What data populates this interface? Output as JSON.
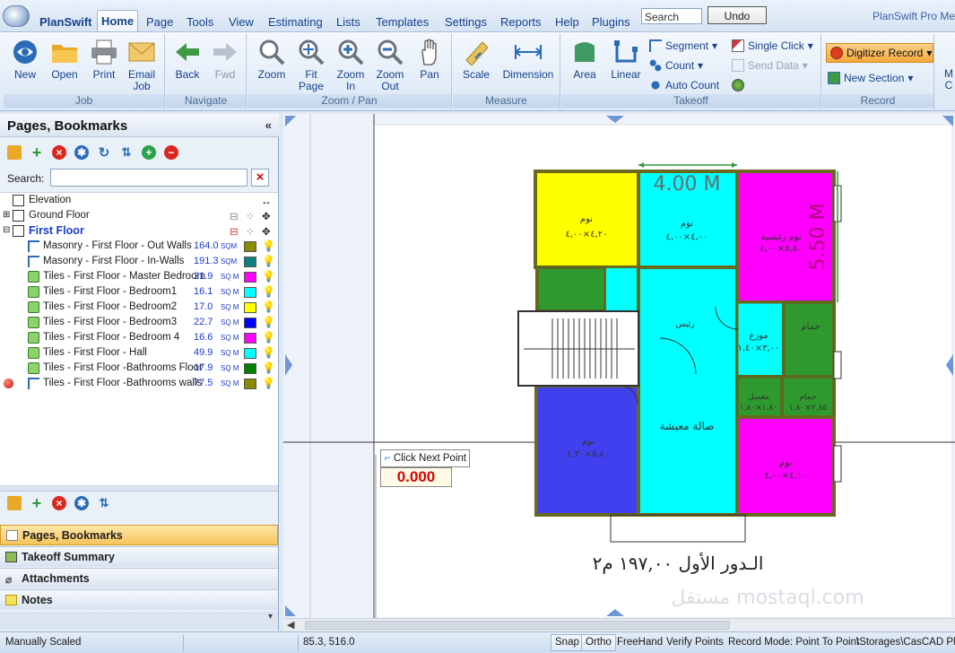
{
  "app": {
    "title": "PlanSwift",
    "brand": "PlanSwift Pro Met"
  },
  "menu": {
    "items": [
      "Home",
      "Page",
      "Tools",
      "View",
      "Estimating",
      "Lists",
      "Templates",
      "Settings",
      "Reports",
      "Help",
      "Plugins"
    ],
    "search_value": "Search",
    "undo_label": "Undo"
  },
  "ribbon": {
    "groups": [
      "Job",
      "Navigate",
      "Zoom / Pan",
      "Measure",
      "Takeoff",
      "Record"
    ],
    "job": {
      "new": "New",
      "open": "Open",
      "print": "Print",
      "email_l1": "Email",
      "email_l2": "Job"
    },
    "navigate": {
      "back": "Back",
      "fwd": "Fwd"
    },
    "zoom": {
      "zoom": "Zoom",
      "fit_l1": "Fit",
      "fit_l2": "Page",
      "zin_l1": "Zoom",
      "zin_l2": "In",
      "zout_l1": "Zoom",
      "zout_l2": "Out",
      "pan": "Pan"
    },
    "measure": {
      "scale": "Scale",
      "dimension": "Dimension"
    },
    "takeoff": {
      "area": "Area",
      "linear": "Linear",
      "segment": "Segment",
      "count": "Count",
      "auto_count": "Auto Count",
      "single_click": "Single Click",
      "send_data": "Send Data"
    },
    "record": {
      "digitizer": "Digitizer Record",
      "new_section": "New Section",
      "more_l1": "M",
      "more_l2": "C"
    }
  },
  "panel": {
    "title": "Pages, Bookmarks",
    "search_label": "Search:",
    "tree": [
      {
        "name": "Elevation",
        "kind": "page"
      },
      {
        "name": "Ground Floor",
        "kind": "page"
      },
      {
        "name": "First Floor",
        "kind": "page-active"
      },
      {
        "name": "Masonry - First Floor - Out Walls",
        "value": "164.0",
        "unit": "SQM",
        "color": "#8b8b00",
        "kind": "linear"
      },
      {
        "name": "Masonry - First Floor - In-Walls",
        "value": "191.3",
        "unit": "SQM",
        "color": "#0f8080",
        "kind": "linear"
      },
      {
        "name": "Tiles - First Floor - Master Bedroom",
        "value": "21.9",
        "unit": "SQ M",
        "color": "#ff00ff",
        "kind": "area"
      },
      {
        "name": "Tiles - First Floor - Bedroom1",
        "value": "16.1",
        "unit": "SQ M",
        "color": "#00ffff",
        "kind": "area"
      },
      {
        "name": "Tiles -  First Floor - Bedroom2",
        "value": "17.0",
        "unit": "SQ M",
        "color": "#ffff00",
        "kind": "area"
      },
      {
        "name": "Tiles -  First Floor -  Bedroom3",
        "value": "22.7",
        "unit": "SQ M",
        "color": "#0000ff",
        "kind": "area"
      },
      {
        "name": "Tiles - First Floor - Bedroom 4",
        "value": "16.6",
        "unit": "SQ M",
        "color": "#ff00ff",
        "kind": "area"
      },
      {
        "name": "Tiles - First Floor - Hall",
        "value": "49.9",
        "unit": "SQ M",
        "color": "#00ffff",
        "kind": "area"
      },
      {
        "name": "Tiles - First Floor -Bathrooms Floor",
        "value": "17.9",
        "unit": "SQ M",
        "color": "#008000",
        "kind": "area"
      },
      {
        "name": "Tiles - First Floor -Bathrooms  walls",
        "value": "77.5",
        "unit": "SQ M",
        "color": "#8b8b00",
        "kind": "linear"
      }
    ],
    "tabs": [
      "Pages, Bookmarks",
      "Takeoff Summary",
      "Attachments",
      "Notes"
    ]
  },
  "canvas": {
    "dim_top": "4.00 M",
    "dim_right": "5.50 M",
    "prompt": "Click Next Point",
    "readout": "0.000",
    "caption": "الـدور الأول ١٩٧,٠٠ م٢",
    "rooms": [
      {
        "label": "نوم",
        "size": "٤,٢٠×٤,٠٠",
        "color": "#ffff00"
      },
      {
        "label": "نوم",
        "size": "٤,٠٠×٤,٠٠",
        "color": "#00ffff"
      },
      {
        "label": "نوم رئيسية",
        "size": "٥,٥٠×٤,٠٠",
        "color": "#ff00ff"
      },
      {
        "label": "صالة معيشة",
        "size": "",
        "color": "#00ffff"
      },
      {
        "label": "موزع",
        "size": "٣,٠٠×١,٤٠",
        "color": "#00ffff"
      },
      {
        "label": "نوم",
        "size": "٥,٤٠×٤,٢٠",
        "color": "#0000ff"
      },
      {
        "label": "نوم",
        "size": "٤,١٠×٤,٠٠",
        "color": "#ff00ff"
      },
      {
        "label": "حمام",
        "size": "",
        "color": "#008000"
      },
      {
        "label": "مغسل",
        "size": "١,٨٠×١,٨٠",
        "color": "#008000"
      },
      {
        "label": "حمام",
        "size": "٢,٨٥×١,٨٠",
        "color": "#008000"
      },
      {
        "label": "رئيس",
        "size": "",
        "color": "#00ffff"
      }
    ],
    "watermark": "مستقل mostaql.com"
  },
  "status": {
    "scale": "Manually Scaled",
    "coords": "85.3, 516.0",
    "snap": "Snap",
    "ortho": "Ortho",
    "freehand": "FreeHand",
    "verify": "Verify Points",
    "record_mode": "Record Mode: Point To Point",
    "path": "\\Storages\\CasCAD Pla"
  }
}
